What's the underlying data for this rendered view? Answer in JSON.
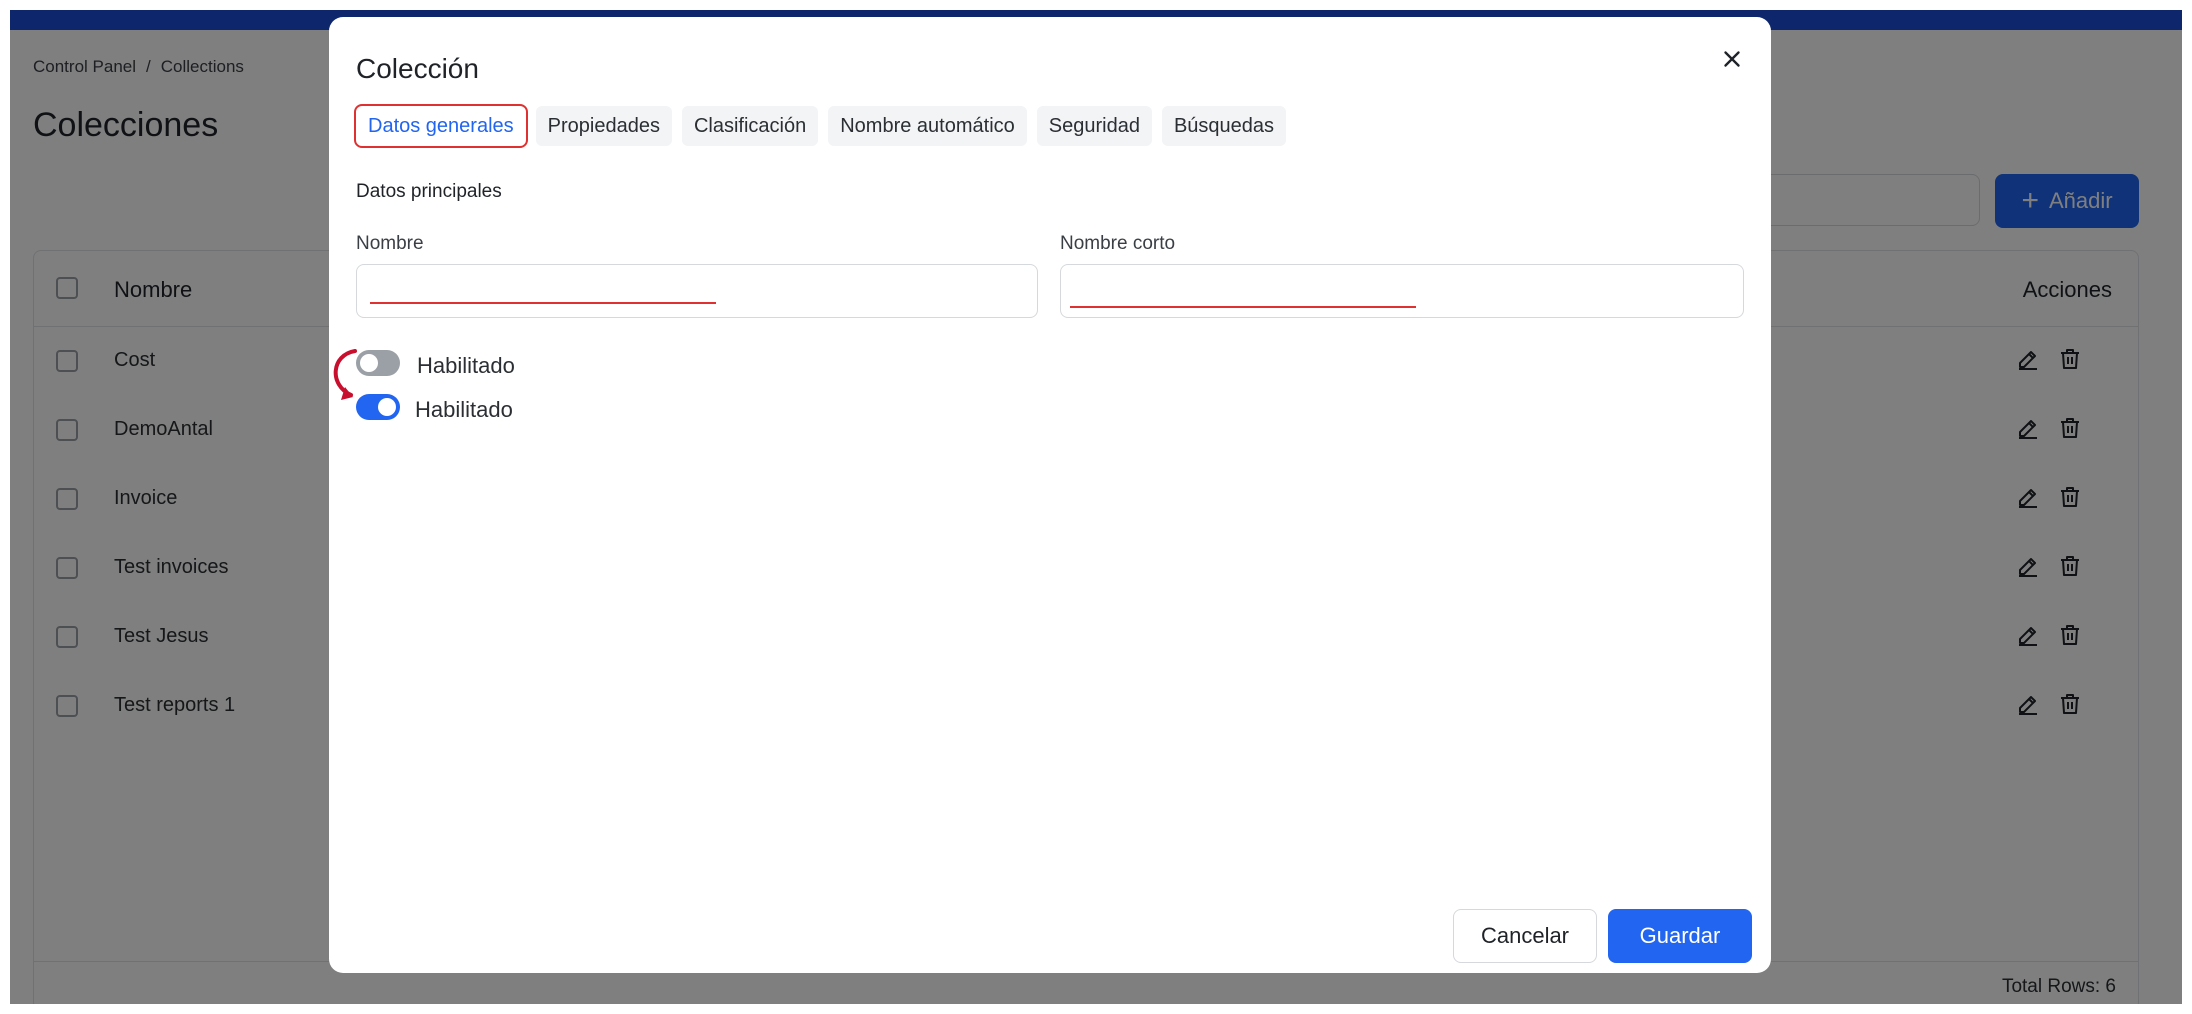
{
  "breadcrumb": {
    "root": "Control Panel",
    "separator": "/",
    "current": "Collections"
  },
  "page": {
    "title": "Colecciones",
    "add_label": "Añadir"
  },
  "table": {
    "columns": {
      "name": "Nombre",
      "actions": "Acciones"
    },
    "rows": [
      "Cost",
      "DemoAntal",
      "Invoice",
      "Test invoices",
      "Test Jesus",
      "Test reports 1"
    ],
    "total_rows": "Total Rows: 6"
  },
  "modal": {
    "title": "Colección",
    "tabs": [
      "Datos generales",
      "Propiedades",
      "Clasificación",
      "Nombre automático",
      "Seguridad",
      "Búsquedas"
    ],
    "active_tab": "Datos generales",
    "section_title": "Datos principales",
    "fields": {
      "name_label": "Nombre",
      "name_value": "",
      "short_name_label": "Nombre corto",
      "short_name_value": ""
    },
    "toggles": [
      {
        "label": "Habilitado",
        "state": "off"
      },
      {
        "label": "Habilitado",
        "state": "on"
      }
    ],
    "cancel_label": "Cancelar",
    "save_label": "Guardar"
  },
  "icons": {
    "close": "close-icon",
    "edit": "pencil-icon",
    "delete": "trash-icon",
    "add": "plus-icon"
  },
  "colors": {
    "primary": "#2165f0",
    "topbar": "#1d4fd8",
    "annotation": "#e03131",
    "toggle_off": "#9aa0a6"
  }
}
